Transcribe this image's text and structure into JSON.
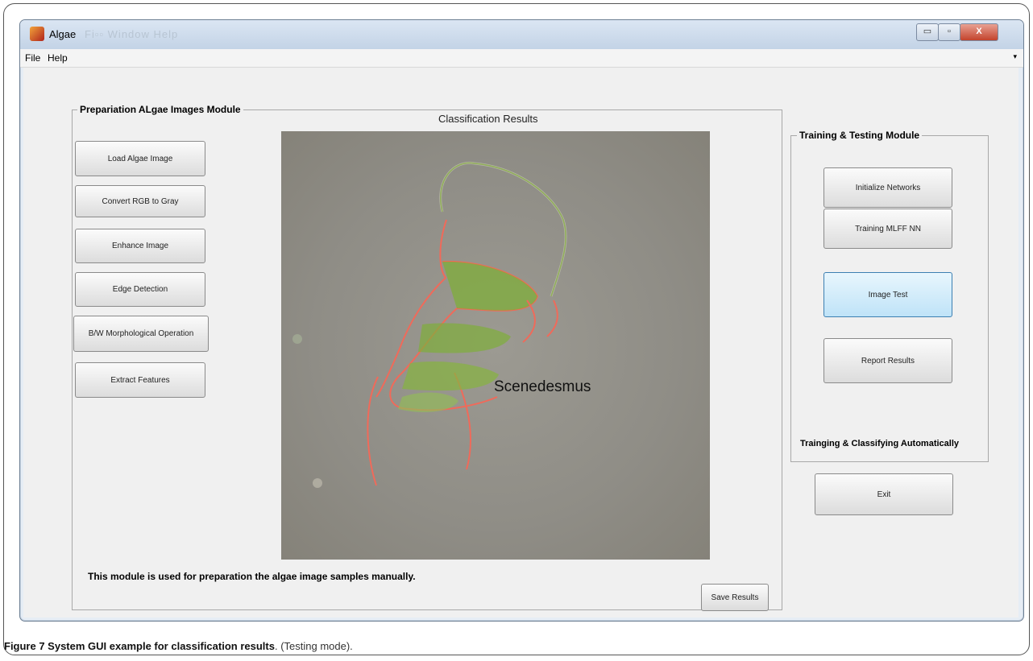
{
  "window": {
    "title": "Algae",
    "blurred_menus": "Fi▫▫   Window   Help"
  },
  "window_controls": {
    "minimize": "▭",
    "maximize": "▫",
    "close": "X"
  },
  "menu": {
    "items": [
      "File",
      "Help"
    ],
    "overflow_arrow": "▾"
  },
  "left_panel": {
    "title": "Prepariation ALgae Images Module",
    "buttons": [
      "Load Algae Image",
      "Convert RGB to Gray",
      "Enhance Image",
      "Edge Detection",
      "B/W Morphological Operation",
      "Extract Features"
    ],
    "note": "This module is used for preparation the algae image samples manually.",
    "save_button": "Save Results"
  },
  "results": {
    "title": "Classification Results",
    "species_label": "Scenedesmus"
  },
  "right_panel": {
    "title": "Training & Testing Module",
    "buttons": [
      "Initialize Networks",
      "Training MLFF NN",
      "Image Test",
      "Report Results"
    ],
    "active_button": "Image Test",
    "footer": "Trainging & Classifying Automatically"
  },
  "exit_button": "Exit",
  "caption": {
    "label": "Figure 7 System GUI example for classification results",
    "rest": ". (Testing mode)."
  },
  "colors": {
    "contour": "#f06a5a",
    "cell": "#7fae3a",
    "background": "#8f8d86"
  }
}
